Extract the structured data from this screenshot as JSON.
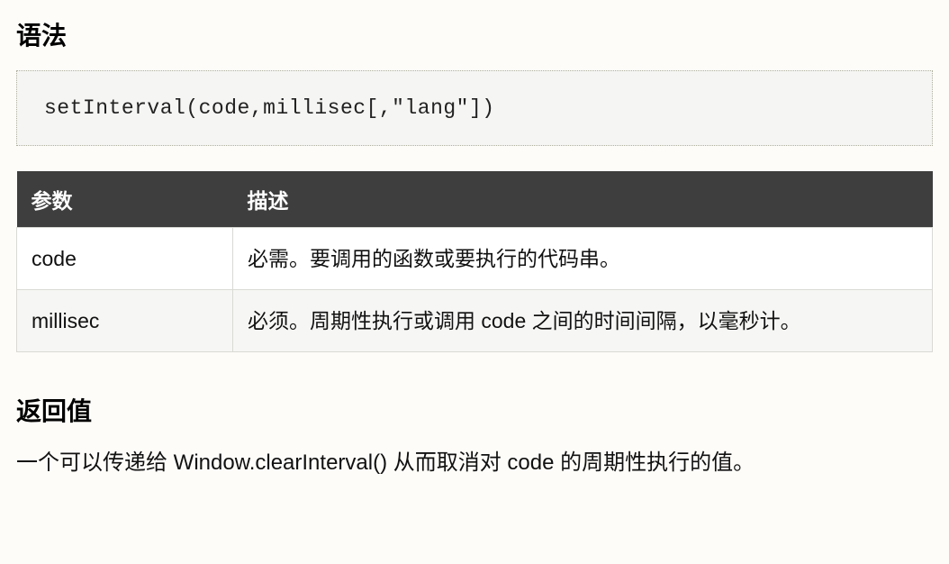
{
  "section1_title": "语法",
  "code_sample": "setInterval(code,millisec[,\"lang\"])",
  "table": {
    "headers": [
      "参数",
      "描述"
    ],
    "rows": [
      {
        "param": "code",
        "desc": "必需。要调用的函数或要执行的代码串。"
      },
      {
        "param": "millisec",
        "desc": "必须。周期性执行或调用 code 之间的时间间隔，以毫秒计。"
      }
    ]
  },
  "section2_title": "返回值",
  "return_desc": "一个可以传递给 Window.clearInterval() 从而取消对 code 的周期性执行的值。"
}
